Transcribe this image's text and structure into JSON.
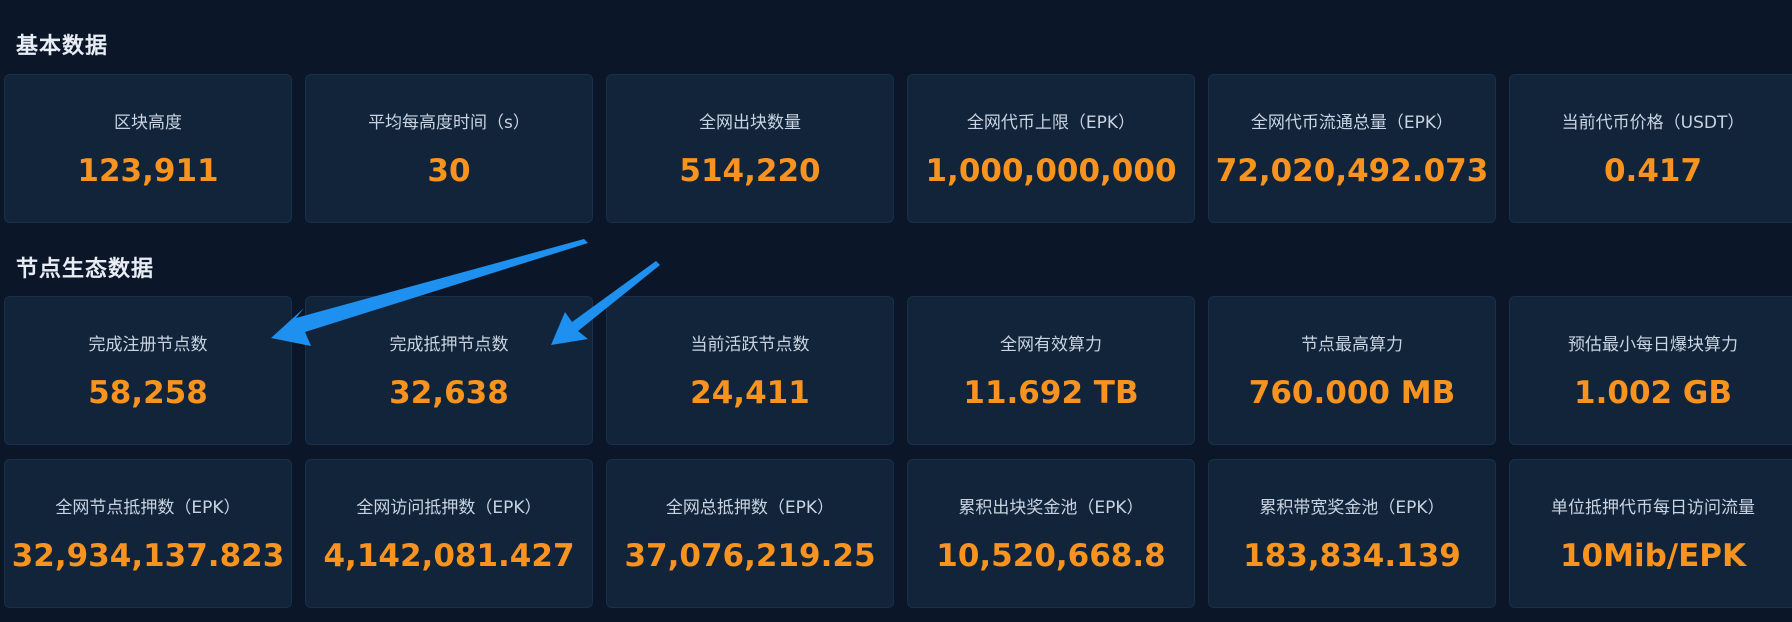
{
  "sections": {
    "basic": {
      "title": "基本数据",
      "cards": [
        {
          "label": "区块高度",
          "value": "123,911"
        },
        {
          "label": "平均每高度时间（s）",
          "value": "30"
        },
        {
          "label": "全网出块数量",
          "value": "514,220"
        },
        {
          "label": "全网代币上限（EPK）",
          "value": "1,000,000,000"
        },
        {
          "label": "全网代币流通总量（EPK）",
          "value": "72,020,492.073"
        },
        {
          "label": "当前代币价格（USDT）",
          "value": "0.417"
        }
      ]
    },
    "node": {
      "title": "节点生态数据",
      "row1": [
        {
          "label": "完成注册节点数",
          "value": "58,258"
        },
        {
          "label": "完成抵押节点数",
          "value": "32,638"
        },
        {
          "label": "当前活跃节点数",
          "value": "24,411"
        },
        {
          "label": "全网有效算力",
          "value": "11.692 TB"
        },
        {
          "label": "节点最高算力",
          "value": "760.000 MB"
        },
        {
          "label": "预估最小每日爆块算力",
          "value": "1.002 GB"
        }
      ],
      "row2": [
        {
          "label": "全网节点抵押数（EPK）",
          "value": "32,934,137.823"
        },
        {
          "label": "全网访问抵押数（EPK）",
          "value": "4,142,081.427"
        },
        {
          "label": "全网总抵押数（EPK）",
          "value": "37,076,219.25"
        },
        {
          "label": "累积出块奖金池（EPK）",
          "value": "10,520,668.8"
        },
        {
          "label": "累积带宽奖金池（EPK）",
          "value": "183,834.139"
        },
        {
          "label": "单位抵押代币每日访问流量",
          "value": "10Mib/EPK"
        }
      ]
    }
  },
  "colors": {
    "background": "#0b1728",
    "card": "#11243a",
    "value": "#f7931e",
    "label": "#c9d3e1",
    "annotation_arrow": "#1e90f0"
  },
  "annotation": {
    "arrow_count": 2,
    "icon": "arrow-icon"
  }
}
